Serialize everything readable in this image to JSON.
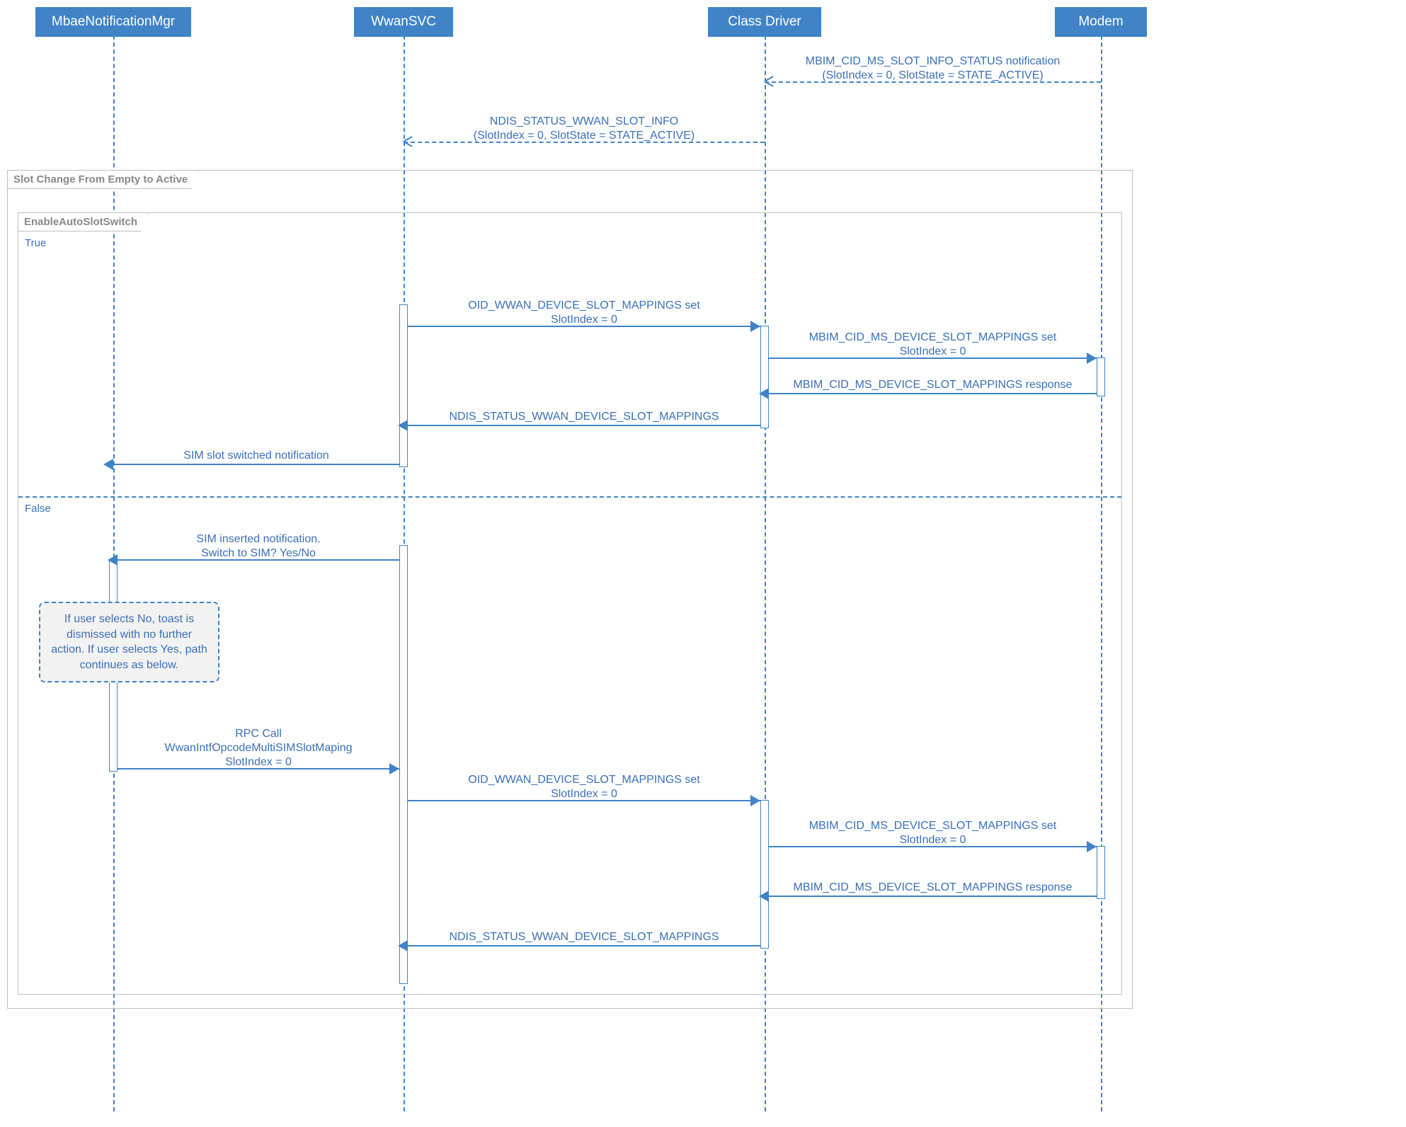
{
  "participants": {
    "mbae": "MbaeNotificationMgr",
    "wwansvc": "WwanSVC",
    "classdriver": "Class Driver",
    "modem": "Modem"
  },
  "frames": {
    "outer": "Slot Change From Empty to Active",
    "inner": "EnableAutoSlotSwitch",
    "guard_true": "True",
    "guard_false": "False"
  },
  "messages": {
    "m1_line1": "MBIM_CID_MS_SLOT_INFO_STATUS notification",
    "m1_line2": "(SlotIndex = 0, SlotState = STATE_ACTIVE)",
    "m2_line1": "NDIS_STATUS_WWAN_SLOT_INFO",
    "m2_line2": "(SlotIndex = 0, SlotState = STATE_ACTIVE)",
    "m3_line1": "OID_WWAN_DEVICE_SLOT_MAPPINGS set",
    "m3_line2": "SlotIndex = 0",
    "m4_line1": "MBIM_CID_MS_DEVICE_SLOT_MAPPINGS set",
    "m4_line2": "SlotIndex = 0",
    "m5": "MBIM_CID_MS_DEVICE_SLOT_MAPPINGS response",
    "m6": "NDIS_STATUS_WWAN_DEVICE_SLOT_MAPPINGS",
    "m7": "SIM slot switched notification",
    "m8_line1": "SIM inserted notification.",
    "m8_line2": "Switch to SIM? Yes/No",
    "m9_line1": "RPC Call",
    "m9_line2": "WwanIntfOpcodeMultiSIMSlotMaping",
    "m9_line3": "SlotIndex = 0",
    "m10_line1": "OID_WWAN_DEVICE_SLOT_MAPPINGS set",
    "m10_line2": "SlotIndex = 0",
    "m11_line1": "MBIM_CID_MS_DEVICE_SLOT_MAPPINGS set",
    "m11_line2": "SlotIndex = 0",
    "m12": "MBIM_CID_MS_DEVICE_SLOT_MAPPINGS response",
    "m13": "NDIS_STATUS_WWAN_DEVICE_SLOT_MAPPINGS"
  },
  "note": "If user selects No, toast is dismissed with no further action. If user selects Yes, path continues as below."
}
